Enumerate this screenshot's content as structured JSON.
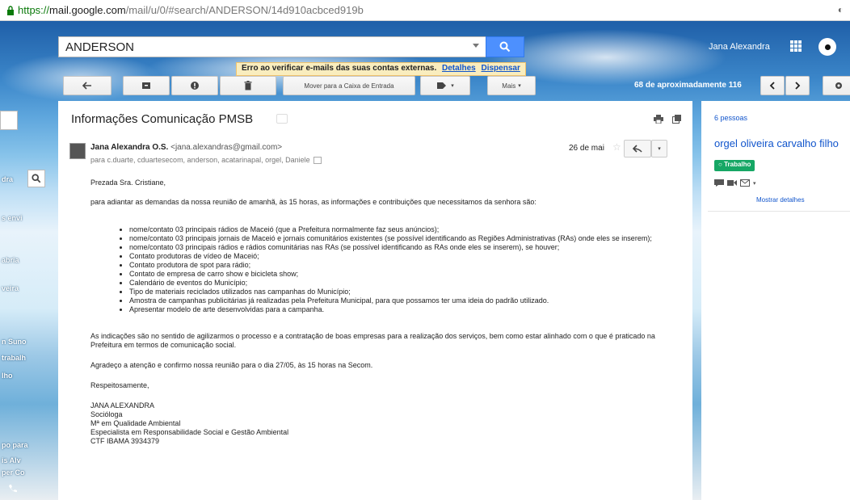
{
  "browser": {
    "url_scheme": "https://",
    "url_host": "mail.google.com",
    "url_path": "/mail/u/0/#search/ANDERSON/14d910acbced919b"
  },
  "header": {
    "search_value": "ANDERSON",
    "account_name": "Jana Alexandra",
    "warning_text": "Erro ao verificar e-mails das suas contas externas.",
    "warning_details": "Detalhes",
    "warning_dismiss": "Dispensar"
  },
  "toolbar": {
    "move_to_inbox": "Mover para a Caixa de Entrada",
    "more": "Mais",
    "count_text": "68 de aproximadamente 116"
  },
  "sidebar": {
    "items": [
      "dra",
      "s envi",
      "abria",
      "veira",
      "n Suno",
      "trabalh",
      "lho",
      "po para",
      "is Alv",
      "per Co"
    ]
  },
  "email": {
    "subject": "Informações Comunicação PMSB",
    "sender_name": "Jana Alexandra O.S.",
    "sender_email": "<jana.alexandras@gmail.com>",
    "recipients": "para c.duarte, cduartesecom, anderson, acatarinapal, orgel, Daniele",
    "date": "26 de mai",
    "greeting": "Prezada Sra. Cristiane,",
    "intro": "para adiantar as demandas da nossa reunião de amanhã, às 15 horas, as informações e contribuições que necessitamos da senhora são:",
    "bullets": [
      "nome/contato 03 principais rádios de Maceió (que a Prefeitura normalmente faz seus anúncios);",
      "nome/contato 03 principais jornais de Maceió e jornais comunitários existentes (se possível identificando as Regiões Administrativas (RAs) onde eles se inserem);",
      "nome/contato 03 principais rádios e rádios comunitárias nas RAs (se possível identificando as RAs onde eles se inserem), se houver;",
      "Contato produtoras de vídeo de Maceió;",
      "Contato produtora de spot para rádio;",
      "Contato de empresa de carro show e bicicleta show;",
      "Calendário de eventos do Município;",
      "Tipo de materiais reciclados utilizados nas campanhas do Município;",
      "Amostra de campanhas publicitárias já realizadas pela Prefeitura Municipal, para que possamos ter uma ideia do padrão utilizado.",
      "Apresentar modelo de arte desenvolvidas para a campanha."
    ],
    "paragraph_1": "As indicações são no sentido de agilizarmos o processo e a contratação de boas empresas para a realização dos serviços, bem como estar alinhado com o que é praticado na Prefeitura em termos de comunicação social.",
    "paragraph_2": "Agradeço a atenção e confirmo nossa reunião para o dia 27/05, às 15 horas na Secom.",
    "closing": "Respeitosamente,",
    "signature": [
      "JANA ALEXANDRA",
      "Socióloga",
      "Mª em Qualidade Ambiental",
      "Especialista em Responsabilidade Social e Gestão Ambiental",
      "CTF IBAMA 3934379"
    ]
  },
  "right_panel": {
    "people": "6 pessoas",
    "contact_name": "orgel oliveira carvalho filho",
    "label": "Trabalho",
    "details_link": "Mostrar detalhes"
  },
  "colors": {
    "accent_blue": "#4d90fe",
    "link_blue": "#1155cc",
    "label_green": "#16a765",
    "warning_bg": "#f9edbe"
  }
}
